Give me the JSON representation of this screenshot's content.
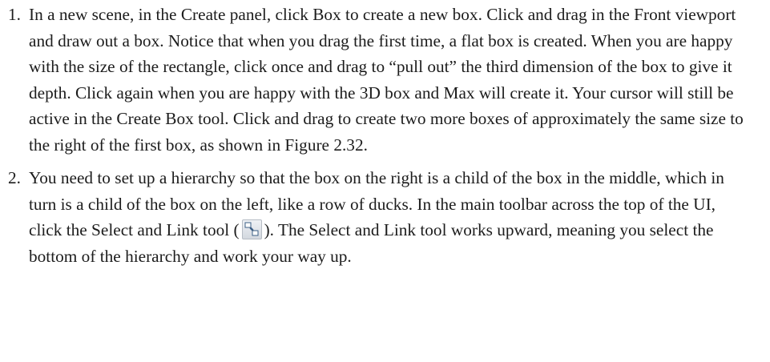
{
  "steps": [
    {
      "number": "1.",
      "text": "In a new scene, in the Create panel, click Box to create a new box. Click and drag in the Front viewport and draw out a box. Notice that when you drag the first time, a flat box is created. When you are happy with the size of the rectangle, click once and drag to “pull out” the third dimension of the box to give it depth. Click again when you are happy with the 3D box and Max will create it. Your cursor will still be active in the Create Box tool. Click and drag to create two more boxes of approximately the same size to the right of the first box, as shown in Figure 2.32."
    },
    {
      "number": "2.",
      "text_before_icon": "You need to set up a hierarchy so that the box on the right is a child of the box in the middle, which in turn is a child of the box on the left, like a row of ducks. In the main toolbar across the top of the UI, click the Select and Link tool (",
      "icon": "select-and-link-icon",
      "text_after_icon": "). The Select and Link tool works upward, meaning you select the bottom of the hierarchy and work your way up."
    }
  ]
}
